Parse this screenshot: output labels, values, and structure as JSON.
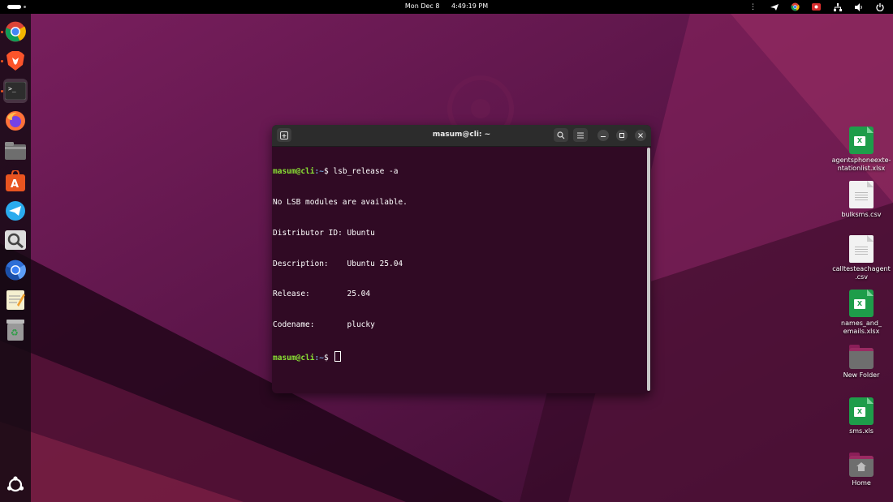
{
  "topbar": {
    "date": "Mon Dec 8",
    "time": "4:49:19 PM",
    "tray_icons": [
      "more-icon",
      "telegram-tray-icon",
      "chrome-tray-icon",
      "recorder-tray-icon",
      "network-icon",
      "volume-icon",
      "power-icon"
    ]
  },
  "dock": {
    "apps": [
      "Google Chrome",
      "Brave Browser",
      "Terminal",
      "Firefox",
      "Files",
      "App Center",
      "Telegram",
      "Image Viewer",
      "Chromium",
      "Text Editor",
      "Trash"
    ],
    "active": "Terminal",
    "show_apps": "show-apps-icon"
  },
  "desktop": {
    "icons": [
      {
        "label": "agentsphoneexte-ntationlist.xlsx",
        "type": "xlsx"
      },
      {
        "label": "bulksms.csv",
        "type": "csv"
      },
      {
        "label": "calltesteachagent.csv",
        "type": "csv"
      },
      {
        "label": "names_and_emails.xlsx",
        "type": "xlsx"
      },
      {
        "label": "New Folder",
        "type": "folder"
      },
      {
        "label": "sms.xls",
        "type": "xlsx"
      },
      {
        "label": "Home",
        "type": "home-folder"
      }
    ],
    "labels": {
      "icon0_l1": "agentsphoneexte-",
      "icon0_l2": "ntationlist.xlsx",
      "icon1": "bulksms.csv",
      "icon2_l1": "calltesteachagent",
      "icon2_l2": ".csv",
      "icon3_l1": "names_and_",
      "icon3_l2": "emails.xlsx",
      "icon4": "New Folder",
      "icon5": "sms.xls",
      "icon6": "Home"
    }
  },
  "terminal": {
    "title": "masum@cli: ~",
    "prompt_user": "masum@cli",
    "prompt_path": ":~",
    "prompt_symbol": "$ ",
    "command": "lsb_release -a",
    "output": [
      "No LSB modules are available.",
      "Distributor ID: Ubuntu",
      "Description:    Ubuntu 25.04",
      "Release:        25.04",
      "Codename:       plucky"
    ]
  },
  "colors": {
    "prompt_user": "#8ae234",
    "prompt_path": "#729fcf",
    "terminal_bg": "#300a24",
    "ubuntu_orange": "#e95420"
  }
}
